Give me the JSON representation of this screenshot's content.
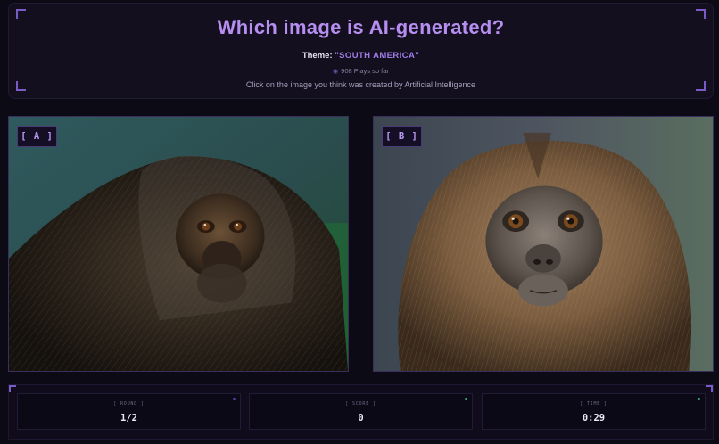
{
  "header": {
    "title": "Which image is AI-generated?",
    "theme_label": "Theme:",
    "theme_value": "\"SOUTH AMERICA\"",
    "plays_icon": "eye-icon",
    "plays_text": "908 Plays so far",
    "instruction": "Click on the image you think was created by Artificial Intelligence"
  },
  "images": [
    {
      "label": "[ A ]",
      "subject": "saki-monkey-photo"
    },
    {
      "label": "[ B ]",
      "subject": "titi-monkey-photo"
    }
  ],
  "stats": {
    "round_label": "[ ROUND ]",
    "round_value": "1/2",
    "score_label": "[ SCORE ]",
    "score_value": "0",
    "time_label": "[ TIME ]",
    "time_value": "0:29"
  },
  "colors": {
    "accent": "#b58ef0",
    "theme": "#a07ce6",
    "background": "#0c0a14",
    "dot_round": "#5a46a8",
    "dot_score": "#2fae7a",
    "dot_time": "#2fae7a"
  }
}
